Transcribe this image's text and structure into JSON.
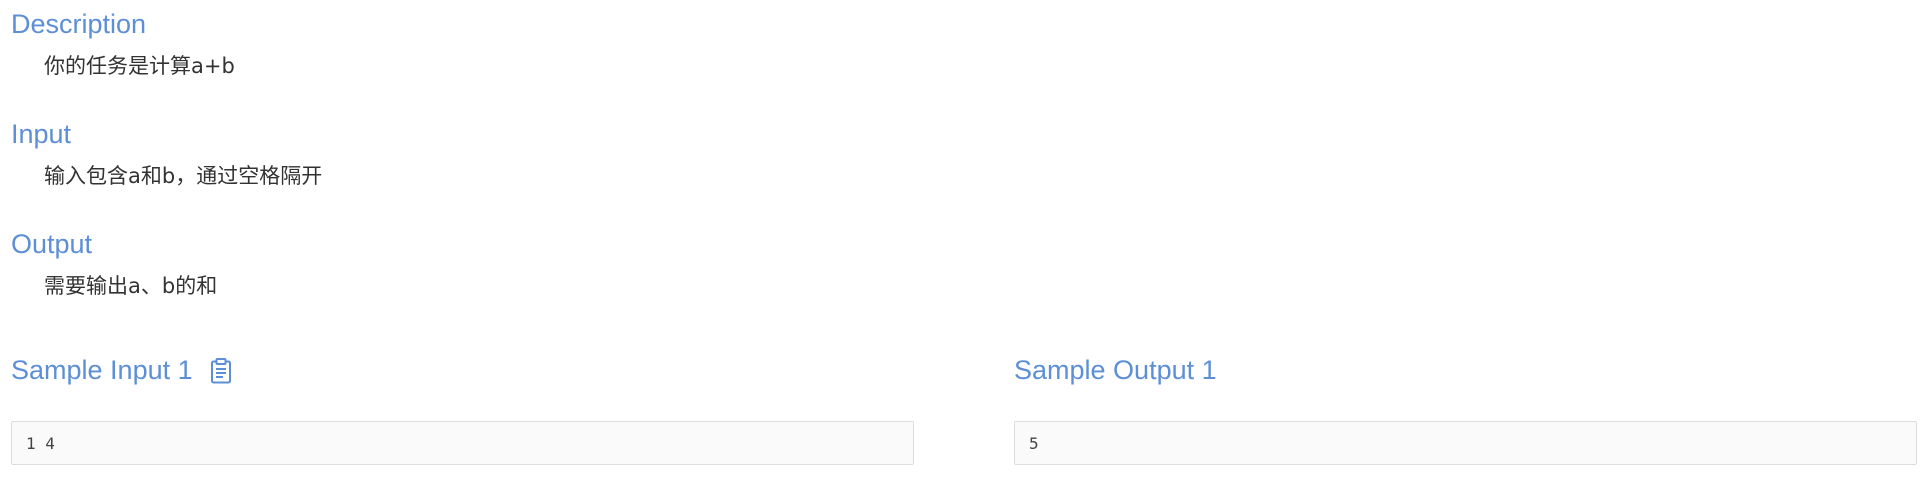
{
  "description": {
    "title": "Description",
    "body": "你的任务是计算a+b"
  },
  "input": {
    "title": "Input",
    "body": "输入包含a和b，通过空格隔开"
  },
  "output": {
    "title": "Output",
    "body": "需要输出a、b的和"
  },
  "sample_input": {
    "title": "Sample Input 1",
    "copy_icon": "clipboard-icon",
    "value": "1 4"
  },
  "sample_output": {
    "title": "Sample Output 1",
    "value": "5"
  },
  "colors": {
    "heading": "#5c8fd6",
    "body_text": "#333333",
    "box_border": "#dddddd",
    "box_background": "#fafafa"
  }
}
